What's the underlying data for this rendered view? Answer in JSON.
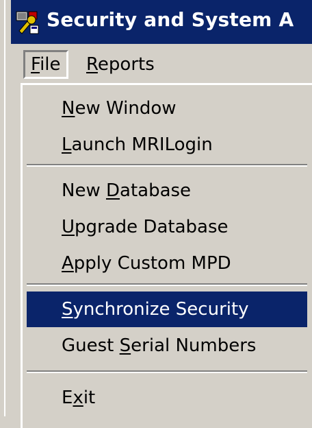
{
  "window": {
    "title": "Security and System A"
  },
  "menubar": {
    "items": [
      {
        "label": "File",
        "accel_pre": "",
        "accel": "F",
        "accel_post": "ile"
      },
      {
        "label": "Reports",
        "accel_pre": "",
        "accel": "R",
        "accel_post": "eports"
      }
    ]
  },
  "file_menu": {
    "items": [
      {
        "label": "New Window",
        "pre": "",
        "accel": "N",
        "post": "ew Window"
      },
      {
        "label": "Launch MRILogin",
        "pre": "",
        "accel": "L",
        "post": "aunch MRILogin"
      },
      {
        "label": "New Database",
        "pre": "New ",
        "accel": "D",
        "post": "atabase"
      },
      {
        "label": "Upgrade Database",
        "pre": "",
        "accel": "U",
        "post": "pgrade Database"
      },
      {
        "label": "Apply Custom MPD",
        "pre": "",
        "accel": "A",
        "post": "pply Custom MPD"
      },
      {
        "label": "Synchronize Security",
        "pre": "",
        "accel": "S",
        "post": "ynchronize Security",
        "selected": true
      },
      {
        "label": "Guest Serial Numbers",
        "pre": "Guest ",
        "accel": "S",
        "post": "erial Numbers"
      },
      {
        "label": "Exit",
        "pre": "E",
        "accel": "x",
        "post": "it"
      }
    ]
  },
  "colors": {
    "titlebar": "#0a246a",
    "menu_bg": "#d4d0c8",
    "selection": "#0a246a"
  },
  "icons": {
    "app": "security-admin-app-icon"
  }
}
